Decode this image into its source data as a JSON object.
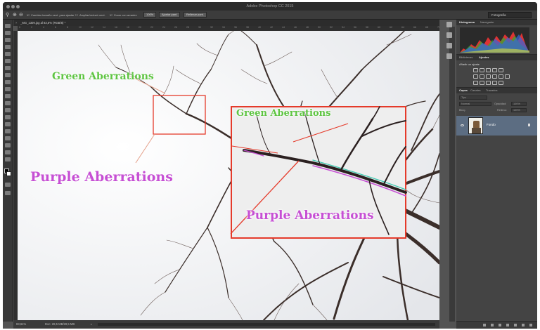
{
  "app": {
    "window_title": "Adobe Photoshop CC 2015"
  },
  "options_bar": {
    "checkbox1": "Cambiar tamaño vent. para ajustar",
    "checkbox2": "Ampliar/reducir vent.",
    "checkbox3": "Zoom con arrastre",
    "btn_100": "100%",
    "btn_fit": "Ajustar pant.",
    "btn_fill": "Rellenar pant.",
    "workspace": "Fotografía"
  },
  "document": {
    "tab": "_MG_1309.jpg al 83,6% (RGB/8) *",
    "ruler_marks": [
      "0",
      "2",
      "4",
      "6",
      "8",
      "10",
      "12",
      "14",
      "16",
      "18",
      "20",
      "22",
      "24",
      "26",
      "28",
      "30",
      "32",
      "34",
      "36",
      "38",
      "40",
      "42",
      "44",
      "46",
      "48",
      "50",
      "52",
      "54",
      "56",
      "58",
      "60",
      "62",
      "64",
      "66",
      "68",
      "70"
    ]
  },
  "status": {
    "zoom": "83,61%",
    "doc": "Doc: 28,5 MB/28,5 MB"
  },
  "panels": {
    "histogram": {
      "tabs": [
        "Histograma",
        "Navegador"
      ]
    },
    "adjustments": {
      "tabs": [
        "Bibliotecas",
        "Ajustes"
      ],
      "label": "Añadir un ajuste"
    },
    "layers": {
      "tabs": [
        "Capas",
        "Canales",
        "Trazados"
      ],
      "filter": "Tipo",
      "blend_mode": "Normal",
      "opacity_label": "Opacidad:",
      "opacity_value": "100%",
      "lock_label": "Bloq.:",
      "fill_label": "Relleno:",
      "fill_value": "100%",
      "layer_name": "Fondo"
    }
  },
  "annotations": {
    "green_small": "Green Aberrations",
    "purple_large": "Purple Aberrations",
    "green_inset": "Green Aberrations",
    "purple_inset": "Purple Aberrations"
  },
  "colors": {
    "green": "#5ec542",
    "purple": "#c64fd4",
    "callout": "#e53a2a"
  }
}
